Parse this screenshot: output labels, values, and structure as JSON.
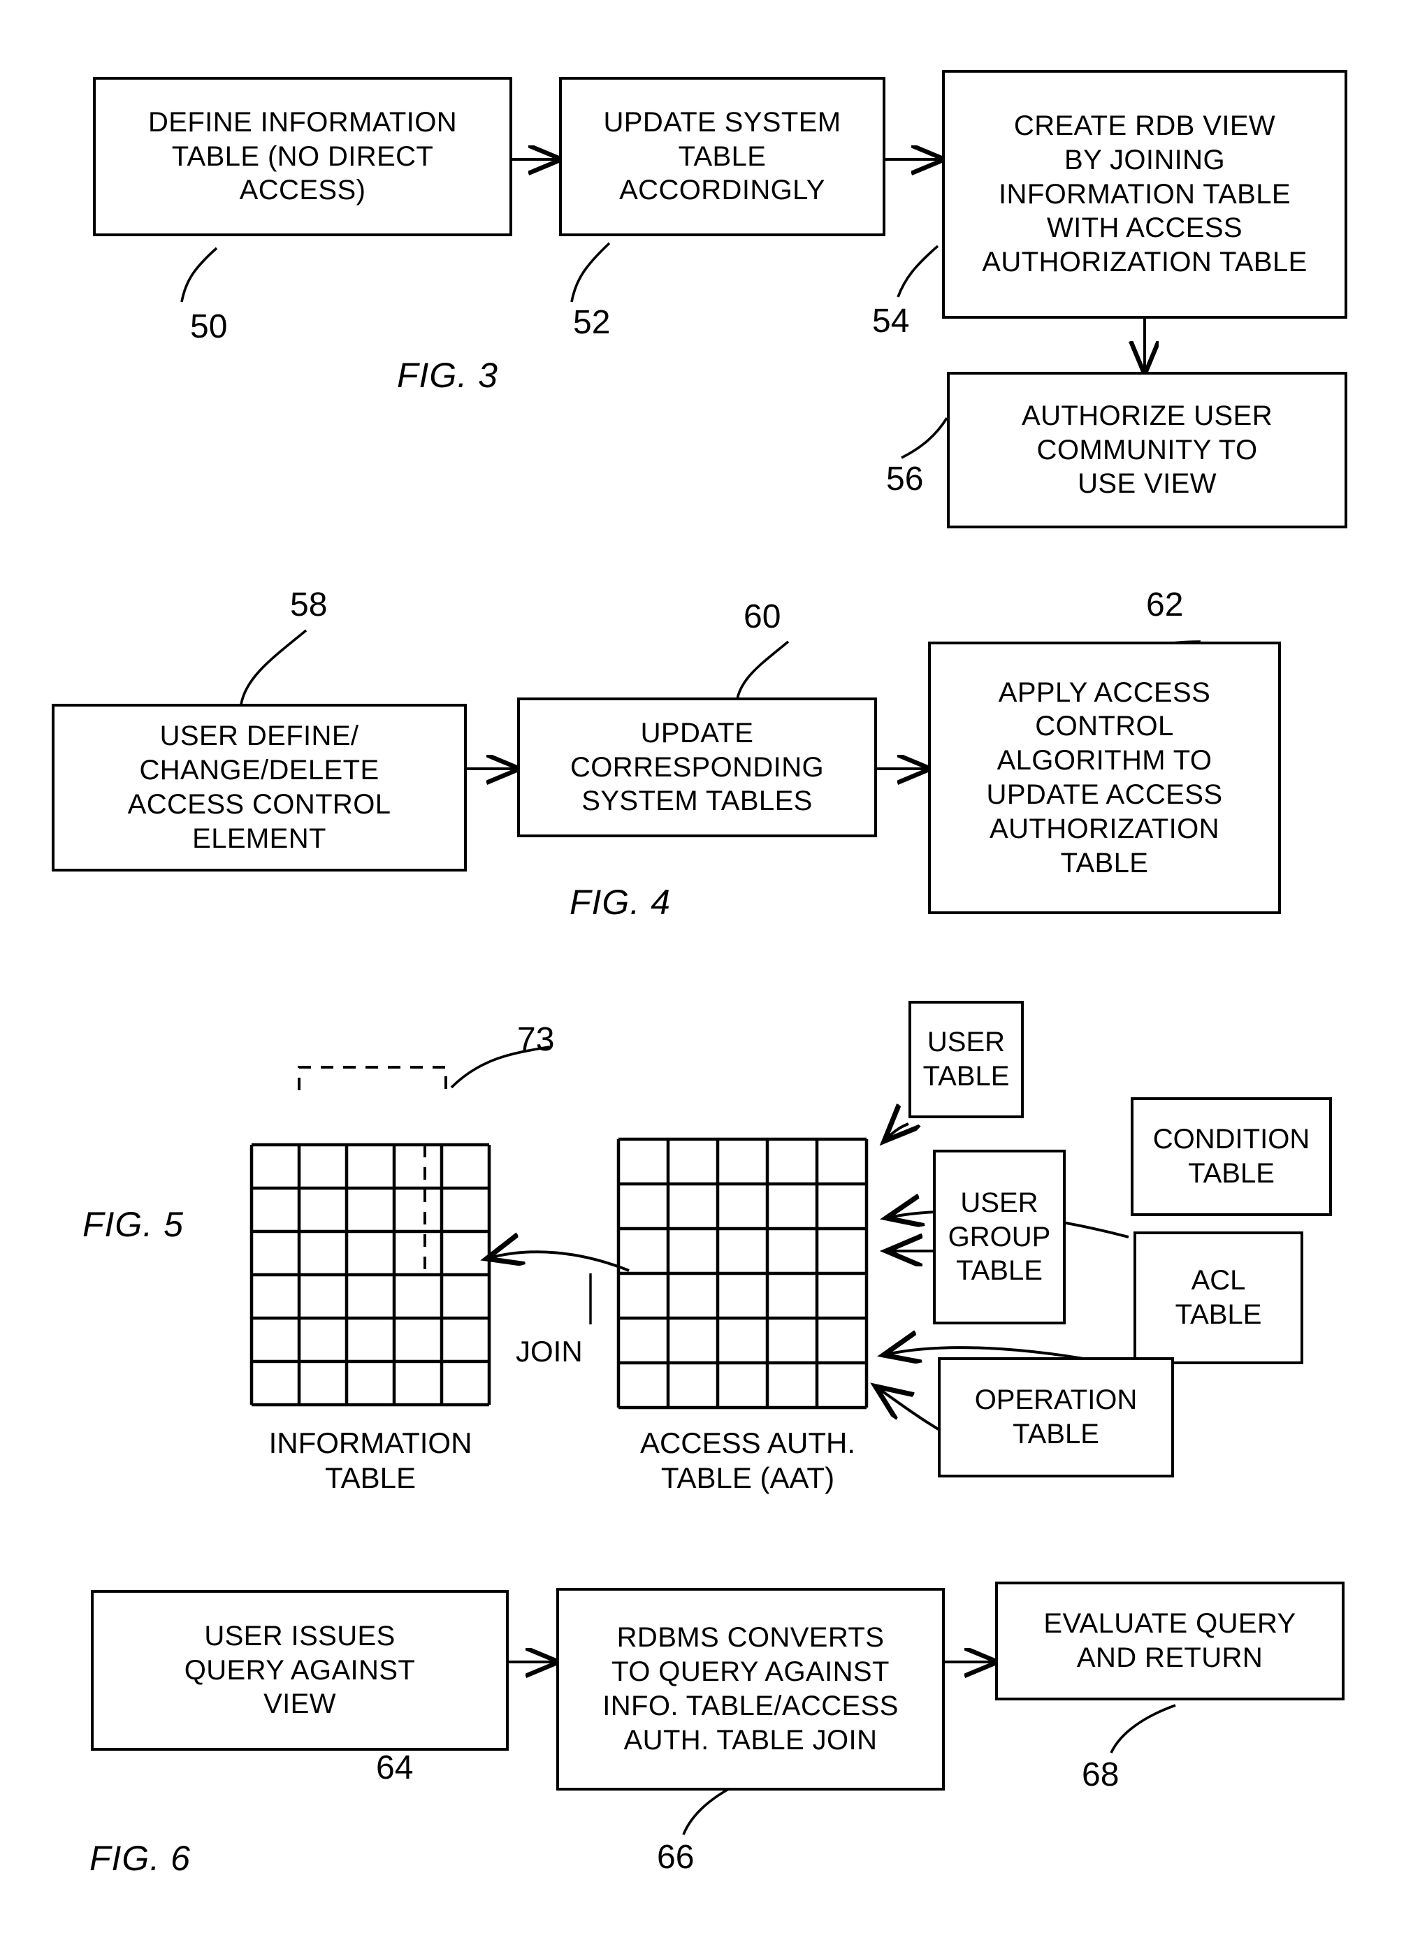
{
  "document": {
    "type": "patent-drawing-sheet",
    "figures": [
      "FIG. 3",
      "FIG. 4",
      "FIG. 5",
      "FIG. 6"
    ]
  },
  "fig3": {
    "label": "FIG. 3",
    "boxes": [
      {
        "id": "50",
        "text": "DEFINE INFORMATION\nTABLE (NO DIRECT\nACCESS)"
      },
      {
        "id": "52",
        "text": "UPDATE SYSTEM\nTABLE\nACCORDINGLY"
      },
      {
        "id": "54",
        "text": "CREATE RDB VIEW\nBY JOINING\nINFORMATION TABLE\nWITH ACCESS\nAUTHORIZATION TABLE"
      },
      {
        "id": "56",
        "text": "AUTHORIZE USER\nCOMMUNITY TO\nUSE VIEW"
      }
    ],
    "refs": [
      "50",
      "52",
      "54",
      "56"
    ]
  },
  "fig4": {
    "label": "FIG. 4",
    "boxes": [
      {
        "id": "58",
        "text": "USER DEFINE/\nCHANGE/DELETE\nACCESS CONTROL\nELEMENT"
      },
      {
        "id": "60",
        "text": "UPDATE\nCORRESPONDING\nSYSTEM TABLES"
      },
      {
        "id": "62",
        "text": "APPLY ACCESS\nCONTROL\nALGORITHM TO\nUPDATE ACCESS\nAUTHORIZATION\nTABLE"
      }
    ],
    "refs": [
      "58",
      "60",
      "62"
    ]
  },
  "fig5": {
    "label": "FIG. 5",
    "ref_73": "73",
    "join_label": "JOIN",
    "grids": [
      {
        "name": "information-table",
        "caption": "INFORMATION\nTABLE",
        "columns": 5,
        "rows": 6
      },
      {
        "name": "access-auth-table",
        "caption": "ACCESS AUTH.\nTABLE (AAT)",
        "columns": 5,
        "rows": 6
      }
    ],
    "source_tables": [
      {
        "id": "user-table",
        "text": "USER\nTABLE"
      },
      {
        "id": "condition-table",
        "text": "CONDITION\nTABLE"
      },
      {
        "id": "user-group-table",
        "text": "USER\nGROUP\nTABLE"
      },
      {
        "id": "acl-table",
        "text": "ACL\nTABLE"
      },
      {
        "id": "operation-table",
        "text": "OPERATION\nTABLE"
      }
    ]
  },
  "fig6": {
    "label": "FIG. 6",
    "boxes": [
      {
        "id": "64",
        "text": "USER ISSUES\nQUERY AGAINST\nVIEW"
      },
      {
        "id": "66",
        "text": "RDBMS CONVERTS\nTO QUERY AGAINST\nINFO. TABLE/ACCESS\nAUTH. TABLE JOIN"
      },
      {
        "id": "68",
        "text": "EVALUATE QUERY\nAND RETURN"
      }
    ],
    "refs": [
      "64",
      "66",
      "68"
    ]
  },
  "colors": {
    "ink": "#000000",
    "paper": "#ffffff"
  }
}
